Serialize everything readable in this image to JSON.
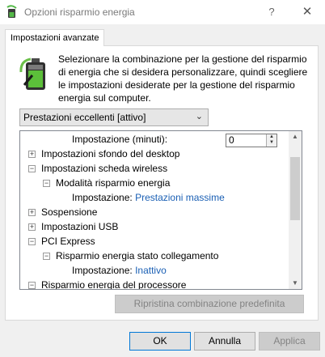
{
  "window": {
    "title": "Opzioni risparmio energia",
    "help_glyph": "?",
    "close_glyph": "✕"
  },
  "tab": {
    "label": "Impostazioni avanzate"
  },
  "description": "Selezionare la combinazione per la gestione del risparmio di energia che si desidera personalizzare, quindi scegliere le impostazioni desiderate per la gestione del risparmio energia sul computer.",
  "plan_select": {
    "value": "Prestazioni eccellenti [attivo]"
  },
  "tree": {
    "setting_minutes": {
      "label": "Impostazione (minuti):",
      "value": "0"
    },
    "desktop_background": "Impostazioni sfondo del desktop",
    "wireless": "Impostazioni scheda wireless",
    "wireless_power_mode": "Modalità risparmio energia",
    "wireless_setting_label": "Impostazione:",
    "wireless_setting_value": "Prestazioni massime",
    "sleep": "Sospensione",
    "usb": "Impostazioni USB",
    "pci_express": "PCI Express",
    "link_state": "Risparmio energia stato collegamento",
    "link_setting_label": "Impostazione:",
    "link_setting_value": "Inattivo",
    "processor": "Risparmio energia del processore"
  },
  "buttons": {
    "restore": "Ripristina combinazione predefinita",
    "ok": "OK",
    "cancel": "Annulla",
    "apply": "Applica"
  },
  "colors": {
    "link_blue": "#1a5fb4",
    "focus_border": "#0078d7"
  }
}
